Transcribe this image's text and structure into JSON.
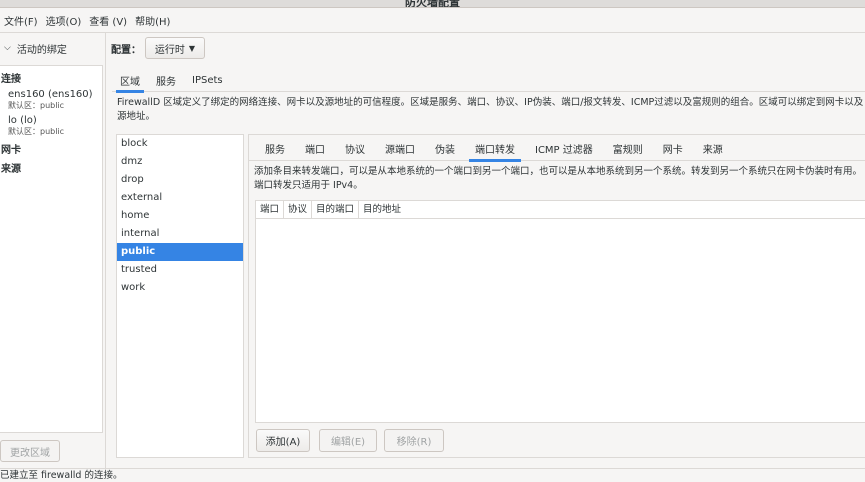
{
  "window": {
    "title": "防火墙配置"
  },
  "menu": [
    {
      "label": "文件(F)"
    },
    {
      "label": "选项(O)"
    },
    {
      "label": "查看 (V)"
    },
    {
      "label": "帮助(H)"
    }
  ],
  "sidebar": {
    "header": "活动的绑定",
    "connections_label": "连接",
    "connections": [
      {
        "name": "ens160 (ens160)",
        "zone": "默认区：public"
      },
      {
        "name": "lo (lo)",
        "zone": "默认区：public"
      }
    ],
    "nic_label": "网卡",
    "source_label": "来源",
    "change_zone_button": "更改区域"
  },
  "config": {
    "label": "配置：",
    "value": "运行时"
  },
  "top_tabs": [
    {
      "label": "区域",
      "active": true
    },
    {
      "label": "服务",
      "active": false
    },
    {
      "label": "IPSets",
      "active": false
    }
  ],
  "zone_description": "FirewallD 区域定义了绑定的网络连接、网卡以及源地址的可信程度。区域是服务、端口、协议、IP伪装、端口/报文转发、ICMP过滤以及富规则的组合。区域可以绑定到网卡以及源地址。",
  "zones": [
    {
      "name": "block",
      "selected": false
    },
    {
      "name": "dmz",
      "selected": false
    },
    {
      "name": "drop",
      "selected": false
    },
    {
      "name": "external",
      "selected": false
    },
    {
      "name": "home",
      "selected": false
    },
    {
      "name": "internal",
      "selected": false
    },
    {
      "name": "public",
      "selected": true
    },
    {
      "name": "trusted",
      "selected": false
    },
    {
      "name": "work",
      "selected": false
    }
  ],
  "zone_tabs": [
    {
      "label": "服务",
      "active": false
    },
    {
      "label": "端口",
      "active": false
    },
    {
      "label": "协议",
      "active": false
    },
    {
      "label": "源端口",
      "active": false
    },
    {
      "label": "伪装",
      "active": false
    },
    {
      "label": "端口转发",
      "active": true
    },
    {
      "label": "ICMP 过滤器",
      "active": false
    },
    {
      "label": "富规则",
      "active": false
    },
    {
      "label": "网卡",
      "active": false
    },
    {
      "label": "来源",
      "active": false
    }
  ],
  "forward_description": "添加条目来转发端口，可以是从本地系统的一个端口到另一个端口，也可以是从本地系统到另一个系统。转发到另一个系统只在网卡伪装时有用。端口转发只适用于 IPv4。",
  "table_columns": [
    "端口",
    "协议",
    "目的端口",
    "目的地址"
  ],
  "buttons": {
    "add": "添加(A)",
    "edit": "编辑(E)",
    "remove": "移除(R)"
  },
  "status": "已建立至 firewalld 的连接。",
  "colors": {
    "accent": "#3584e4",
    "selected_text": "#ffffff"
  }
}
